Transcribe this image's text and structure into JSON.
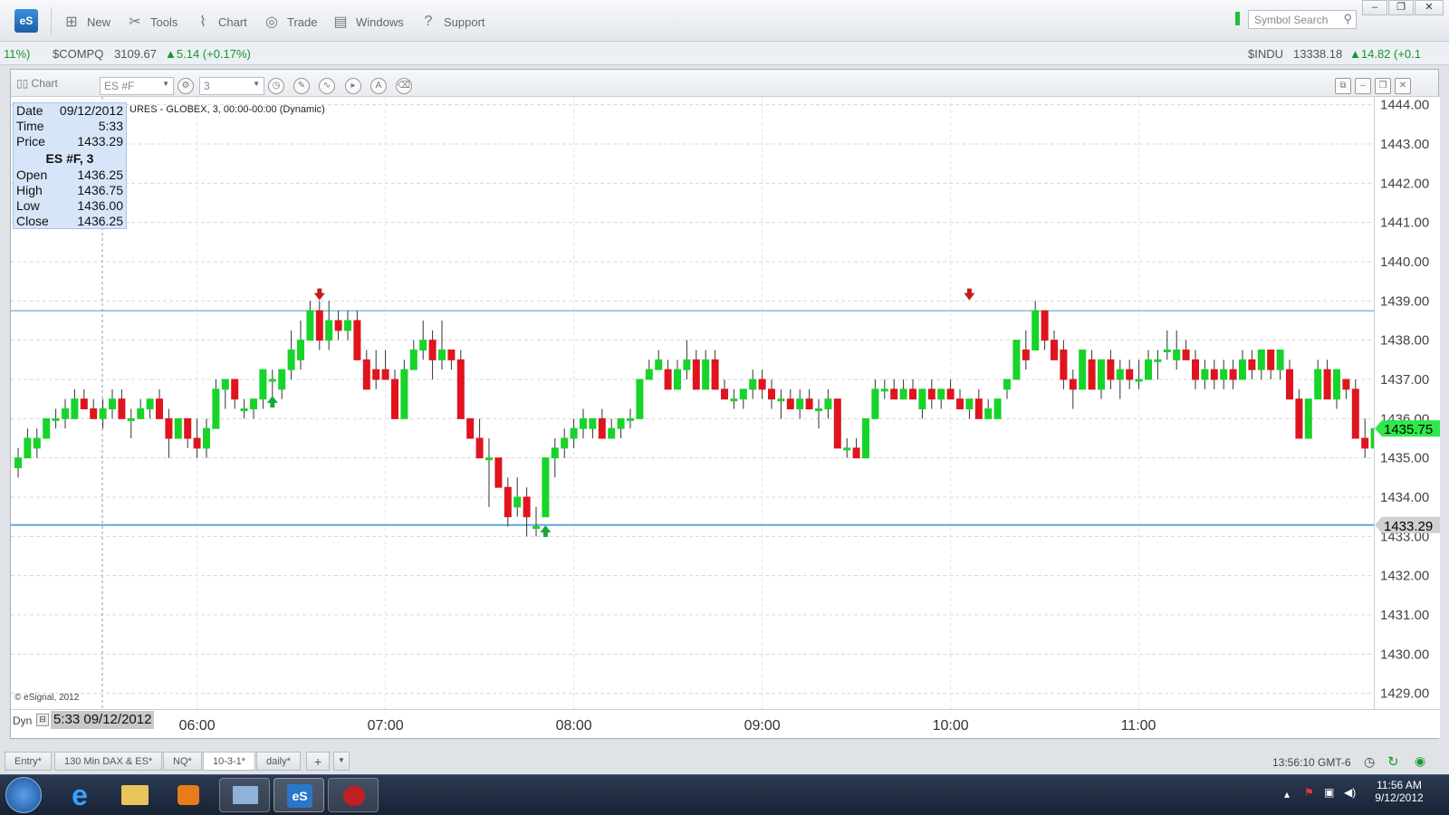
{
  "toolbar": {
    "logo": "eS",
    "items": [
      {
        "label": "New",
        "icon": "new-chart-icon"
      },
      {
        "label": "Tools",
        "icon": "tools-icon"
      },
      {
        "label": "Chart",
        "icon": "chart-icon"
      },
      {
        "label": "Trade",
        "icon": "trade-icon"
      },
      {
        "label": "Windows",
        "icon": "windows-icon"
      },
      {
        "label": "Support",
        "icon": "support-icon"
      }
    ],
    "search_placeholder": "Symbol Search"
  },
  "ticker": {
    "left_fragment": "11%)",
    "compq_symbol": "$COMPQ",
    "compq_price": "3109.67",
    "compq_change": "▲5.14 (+0.17%)",
    "indu_symbol": "$INDU",
    "indu_price": "13338.18",
    "indu_change": "▲14.82 (+0.1"
  },
  "chart_window": {
    "label": "Chart",
    "symbol": "ES #F",
    "interval": "3",
    "title_line": "URES - GLOBEX, 3, 00:00-00:00 (Dynamic)",
    "copyright": "© eSignal, 2012",
    "dyn_label": "Dyn",
    "cursor_label": "5:33 09/12/2012",
    "last_price_label": "1435.75",
    "cursor_price_label": "1433.29"
  },
  "data_window": {
    "date_label": "Date",
    "date": "09/12/2012",
    "time_label": "Time",
    "time": "5:33",
    "price_label": "Price",
    "price": "1433.29",
    "symbol_header": "ES #F, 3",
    "open_label": "Open",
    "open": "1436.25",
    "high_label": "High",
    "high": "1436.75",
    "low_label": "Low",
    "low": "1436.00",
    "close_label": "Close",
    "close": "1436.25"
  },
  "tabs": [
    "Entry*",
    "130 Min DAX & ES*",
    "NQ*",
    "10-3-1*",
    "daily*"
  ],
  "active_tab": "10-3-1*",
  "status_time": "13:56:10 GMT-6",
  "taskbar": {
    "time": "11:56 AM",
    "date": "9/12/2012"
  },
  "colors": {
    "up": "#17d42a",
    "down": "#e0141e",
    "hline": "#3aa3c4",
    "price_tag": "#2ee84a"
  },
  "chart_data": {
    "type": "candlestick",
    "y_ticks": [
      "1444.00",
      "1443.00",
      "1442.00",
      "1441.00",
      "1440.00",
      "1439.00",
      "1438.00",
      "1437.00",
      "1436.00",
      "1435.00",
      "1434.00",
      "1433.00",
      "1432.00",
      "1431.00",
      "1430.00",
      "1429.00"
    ],
    "x_ticks": [
      "06:00",
      "07:00",
      "08:00",
      "09:00",
      "10:00",
      "11:00"
    ],
    "ylim": [
      1428.6,
      1444.2
    ],
    "horizontal_lines": [
      1438.75,
      1433.29
    ],
    "candles": [
      [
        1434.75,
        1435.25,
        1434.5,
        1435.0
      ],
      [
        1435.0,
        1435.75,
        1435.0,
        1435.5
      ],
      [
        1435.25,
        1435.75,
        1435.0,
        1435.5
      ],
      [
        1435.5,
        1436.0,
        1435.5,
        1436.0
      ],
      [
        1436.0,
        1436.25,
        1435.75,
        1436.0
      ],
      [
        1436.0,
        1436.5,
        1435.75,
        1436.25
      ],
      [
        1436.0,
        1436.75,
        1436.0,
        1436.5
      ],
      [
        1436.5,
        1436.75,
        1436.25,
        1436.25
      ],
      [
        1436.25,
        1436.5,
        1436.0,
        1436.0
      ],
      [
        1436.0,
        1436.5,
        1435.75,
        1436.25
      ],
      [
        1436.25,
        1436.75,
        1436.0,
        1436.5
      ],
      [
        1436.5,
        1436.75,
        1436.0,
        1436.0
      ],
      [
        1436.0,
        1436.25,
        1435.5,
        1436.0
      ],
      [
        1436.0,
        1436.5,
        1436.0,
        1436.25
      ],
      [
        1436.25,
        1436.5,
        1436.0,
        1436.5
      ],
      [
        1436.5,
        1436.75,
        1436.0,
        1436.0
      ],
      [
        1436.0,
        1436.25,
        1435.0,
        1435.5
      ],
      [
        1435.5,
        1436.0,
        1435.5,
        1436.0
      ],
      [
        1436.0,
        1436.0,
        1435.25,
        1435.5
      ],
      [
        1435.5,
        1436.0,
        1435.0,
        1435.25
      ],
      [
        1435.25,
        1436.0,
        1435.0,
        1435.75
      ],
      [
        1435.75,
        1437.0,
        1435.75,
        1436.75
      ],
      [
        1436.75,
        1437.0,
        1436.25,
        1437.0
      ],
      [
        1437.0,
        1437.0,
        1436.25,
        1436.5
      ],
      [
        1436.25,
        1436.5,
        1436.0,
        1436.25
      ],
      [
        1436.25,
        1436.5,
        1436.0,
        1436.5
      ],
      [
        1436.5,
        1437.0,
        1436.25,
        1437.25
      ],
      [
        1437.0,
        1437.25,
        1436.5,
        1437.0
      ],
      [
        1436.75,
        1437.25,
        1436.5,
        1437.25
      ],
      [
        1437.25,
        1438.25,
        1437.0,
        1437.75
      ],
      [
        1437.5,
        1438.5,
        1437.25,
        1438.0
      ],
      [
        1438.0,
        1439.0,
        1438.0,
        1438.75
      ],
      [
        1438.75,
        1439.0,
        1437.75,
        1438.0
      ],
      [
        1438.0,
        1439.0,
        1437.75,
        1438.5
      ],
      [
        1438.5,
        1438.75,
        1438.0,
        1438.25
      ],
      [
        1438.25,
        1438.75,
        1438.0,
        1438.5
      ],
      [
        1438.5,
        1438.75,
        1437.5,
        1437.5
      ],
      [
        1437.5,
        1437.75,
        1436.75,
        1436.75
      ],
      [
        1437.25,
        1437.75,
        1436.75,
        1437.0
      ],
      [
        1437.25,
        1437.75,
        1437.0,
        1437.0
      ],
      [
        1437.0,
        1437.25,
        1436.0,
        1436.0
      ],
      [
        1436.0,
        1437.5,
        1436.0,
        1437.25
      ],
      [
        1437.25,
        1438.0,
        1437.25,
        1437.75
      ],
      [
        1437.75,
        1438.5,
        1437.5,
        1438.0
      ],
      [
        1438.0,
        1438.25,
        1437.0,
        1437.5
      ],
      [
        1437.5,
        1438.5,
        1437.25,
        1437.75
      ],
      [
        1437.75,
        1437.75,
        1437.25,
        1437.5
      ],
      [
        1437.5,
        1437.75,
        1436.0,
        1436.0
      ],
      [
        1436.0,
        1436.0,
        1435.5,
        1435.5
      ],
      [
        1435.5,
        1436.0,
        1435.0,
        1435.0
      ],
      [
        1435.0,
        1435.5,
        1433.75,
        1435.0
      ],
      [
        1435.0,
        1435.0,
        1434.25,
        1434.25
      ],
      [
        1434.25,
        1434.5,
        1433.25,
        1433.5
      ],
      [
        1433.75,
        1434.5,
        1433.5,
        1434.0
      ],
      [
        1434.0,
        1434.25,
        1433.0,
        1433.5
      ],
      [
        1433.25,
        1433.75,
        1433.0,
        1433.25
      ],
      [
        1433.5,
        1435.0,
        1433.5,
        1435.0
      ],
      [
        1435.0,
        1435.5,
        1434.5,
        1435.25
      ],
      [
        1435.25,
        1435.75,
        1435.0,
        1435.5
      ],
      [
        1435.5,
        1436.0,
        1435.25,
        1435.75
      ],
      [
        1435.75,
        1436.25,
        1435.5,
        1436.0
      ],
      [
        1435.75,
        1436.0,
        1435.5,
        1436.0
      ],
      [
        1436.0,
        1436.25,
        1435.5,
        1435.5
      ],
      [
        1435.5,
        1436.0,
        1435.5,
        1435.75
      ],
      [
        1435.75,
        1436.0,
        1435.5,
        1436.0
      ],
      [
        1436.0,
        1436.25,
        1435.75,
        1436.0
      ],
      [
        1436.0,
        1437.0,
        1436.0,
        1437.0
      ],
      [
        1437.0,
        1437.5,
        1437.0,
        1437.25
      ],
      [
        1437.25,
        1437.75,
        1437.25,
        1437.5
      ],
      [
        1437.25,
        1437.5,
        1436.75,
        1436.75
      ],
      [
        1436.75,
        1437.5,
        1436.75,
        1437.25
      ],
      [
        1437.25,
        1438.0,
        1437.0,
        1437.5
      ],
      [
        1437.5,
        1437.75,
        1436.75,
        1436.75
      ],
      [
        1436.75,
        1437.75,
        1436.75,
        1437.5
      ],
      [
        1437.5,
        1437.75,
        1436.75,
        1436.75
      ],
      [
        1436.75,
        1437.0,
        1436.5,
        1436.5
      ],
      [
        1436.5,
        1436.75,
        1436.25,
        1436.5
      ],
      [
        1436.5,
        1436.75,
        1436.25,
        1436.75
      ],
      [
        1436.75,
        1437.25,
        1436.5,
        1437.0
      ],
      [
        1437.0,
        1437.25,
        1436.5,
        1436.75
      ],
      [
        1436.75,
        1437.0,
        1436.25,
        1436.5
      ],
      [
        1436.5,
        1436.75,
        1436.0,
        1436.5
      ],
      [
        1436.5,
        1436.75,
        1436.25,
        1436.25
      ],
      [
        1436.25,
        1436.75,
        1436.0,
        1436.5
      ],
      [
        1436.5,
        1436.75,
        1436.25,
        1436.25
      ],
      [
        1436.25,
        1436.5,
        1435.75,
        1436.25
      ],
      [
        1436.25,
        1436.75,
        1436.0,
        1436.5
      ],
      [
        1436.5,
        1436.5,
        1435.25,
        1435.25
      ],
      [
        1435.25,
        1435.5,
        1435.0,
        1435.25
      ],
      [
        1435.25,
        1435.5,
        1435.0,
        1435.0
      ],
      [
        1435.0,
        1436.0,
        1435.0,
        1436.0
      ],
      [
        1436.0,
        1437.0,
        1436.0,
        1436.75
      ],
      [
        1436.75,
        1437.0,
        1436.5,
        1436.75
      ],
      [
        1436.75,
        1437.0,
        1436.5,
        1436.5
      ],
      [
        1436.5,
        1437.0,
        1436.5,
        1436.75
      ],
      [
        1436.75,
        1437.0,
        1436.5,
        1436.5
      ],
      [
        1436.25,
        1436.75,
        1436.0,
        1436.75
      ],
      [
        1436.75,
        1437.0,
        1436.25,
        1436.5
      ],
      [
        1436.5,
        1436.75,
        1436.25,
        1436.75
      ],
      [
        1436.75,
        1437.0,
        1436.5,
        1436.5
      ],
      [
        1436.5,
        1436.75,
        1436.25,
        1436.25
      ],
      [
        1436.25,
        1436.5,
        1436.0,
        1436.5
      ],
      [
        1436.5,
        1436.75,
        1436.0,
        1436.0
      ],
      [
        1436.0,
        1436.5,
        1436.0,
        1436.25
      ],
      [
        1436.0,
        1436.5,
        1436.0,
        1436.5
      ],
      [
        1436.75,
        1437.0,
        1436.5,
        1437.0
      ],
      [
        1437.0,
        1438.0,
        1437.0,
        1438.0
      ],
      [
        1437.75,
        1438.25,
        1437.25,
        1437.5
      ],
      [
        1437.75,
        1439.0,
        1437.75,
        1438.75
      ],
      [
        1438.75,
        1438.75,
        1437.75,
        1438.0
      ],
      [
        1438.0,
        1438.25,
        1437.5,
        1437.5
      ],
      [
        1437.75,
        1438.0,
        1436.75,
        1437.0
      ],
      [
        1437.0,
        1437.25,
        1436.25,
        1436.75
      ],
      [
        1436.75,
        1437.75,
        1436.75,
        1437.75
      ],
      [
        1437.5,
        1437.75,
        1436.75,
        1436.75
      ],
      [
        1436.75,
        1437.5,
        1436.5,
        1437.5
      ],
      [
        1437.5,
        1437.75,
        1436.75,
        1437.0
      ],
      [
        1437.0,
        1437.5,
        1436.5,
        1437.25
      ],
      [
        1437.25,
        1437.5,
        1436.75,
        1437.0
      ],
      [
        1437.0,
        1437.5,
        1436.75,
        1437.0
      ],
      [
        1437.0,
        1437.75,
        1437.0,
        1437.5
      ],
      [
        1437.5,
        1437.75,
        1437.0,
        1437.5
      ],
      [
        1437.75,
        1438.25,
        1437.5,
        1437.75
      ],
      [
        1437.5,
        1438.25,
        1437.25,
        1437.75
      ],
      [
        1437.75,
        1438.0,
        1437.5,
        1437.5
      ],
      [
        1437.5,
        1437.75,
        1436.75,
        1437.0
      ],
      [
        1437.0,
        1437.5,
        1436.75,
        1437.25
      ],
      [
        1437.25,
        1437.5,
        1436.75,
        1437.0
      ],
      [
        1437.0,
        1437.5,
        1436.75,
        1437.25
      ],
      [
        1437.25,
        1437.5,
        1436.75,
        1437.0
      ],
      [
        1437.0,
        1437.75,
        1437.0,
        1437.5
      ],
      [
        1437.5,
        1437.75,
        1437.0,
        1437.25
      ],
      [
        1437.25,
        1437.75,
        1437.0,
        1437.75
      ],
      [
        1437.75,
        1437.75,
        1437.0,
        1437.25
      ],
      [
        1437.25,
        1437.75,
        1437.0,
        1437.75
      ],
      [
        1437.25,
        1437.5,
        1436.5,
        1436.5
      ],
      [
        1436.5,
        1436.75,
        1435.5,
        1435.5
      ],
      [
        1435.5,
        1436.5,
        1435.5,
        1436.5
      ],
      [
        1436.5,
        1437.5,
        1436.5,
        1437.25
      ],
      [
        1437.25,
        1437.5,
        1436.5,
        1436.5
      ],
      [
        1436.5,
        1437.25,
        1436.25,
        1437.25
      ],
      [
        1437.0,
        1437.0,
        1436.5,
        1436.75
      ],
      [
        1436.75,
        1437.0,
        1435.5,
        1435.5
      ],
      [
        1435.5,
        1436.0,
        1435.0,
        1435.25
      ],
      [
        1435.25,
        1435.75,
        1435.0,
        1435.75
      ],
      [
        1435.75,
        1435.75,
        1435.0,
        1435.25
      ],
      [
        1435.25,
        1436.25,
        1434.5,
        1435.5
      ],
      [
        1435.5,
        1436.0,
        1435.25,
        1435.75
      ],
      [
        1435.5,
        1436.0,
        1435.25,
        1435.75
      ]
    ],
    "markers": [
      {
        "type": "up-arrow",
        "index": 27,
        "price": 1436.4
      },
      {
        "type": "down-arrow",
        "index": 32,
        "price": 1439.2
      },
      {
        "type": "up-arrow",
        "index": 56,
        "price": 1433.1
      },
      {
        "type": "down-arrow",
        "index": 101,
        "price": 1439.2
      }
    ]
  }
}
